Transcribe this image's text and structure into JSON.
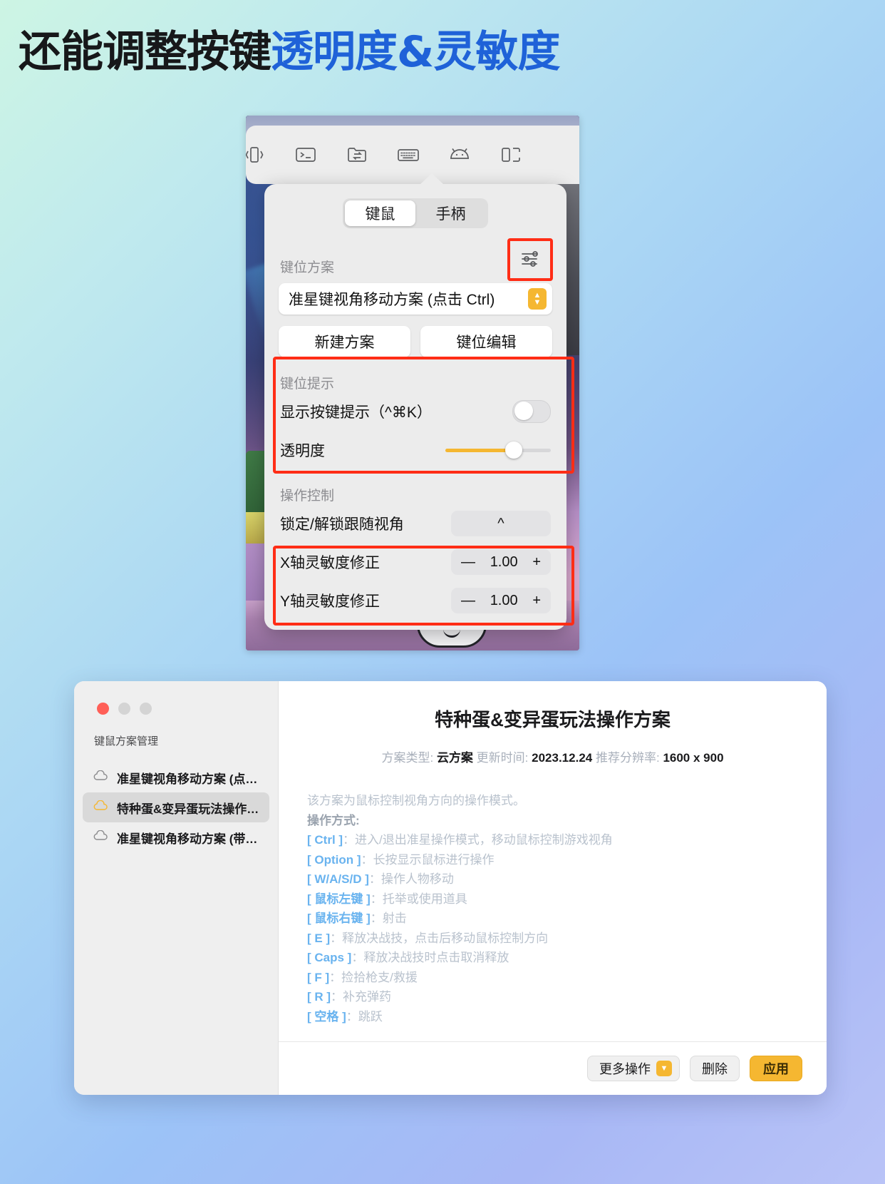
{
  "title": {
    "black": "还能调整按键",
    "blue": "透明度&灵敏度"
  },
  "colors": {
    "accent_blue": "#1f62d8",
    "accent_yellow": "#f5b731",
    "annotation_red": "#ff2d16"
  },
  "mirror_toolbar": {
    "icons": [
      {
        "name": "shake-device-icon",
        "label": "摇一摇"
      },
      {
        "name": "terminal-icon",
        "label": "终端"
      },
      {
        "name": "file-transfer-icon",
        "label": "文件传输"
      },
      {
        "name": "keyboard-icon",
        "label": "键鼠方案"
      },
      {
        "name": "android-icon",
        "label": "安卓"
      },
      {
        "name": "split-screen-icon",
        "label": "分屏"
      }
    ]
  },
  "popover": {
    "segments": [
      {
        "label": "键鼠",
        "active": true
      },
      {
        "label": "手柄",
        "active": false
      }
    ],
    "scheme_section": {
      "label": "键位方案",
      "settings_icon": "sliders-icon",
      "selected_scheme": "准星键视角移动方案 (点击 Ctrl)",
      "buttons": [
        {
          "label": "新建方案"
        },
        {
          "label": "键位编辑"
        }
      ]
    },
    "hint_section": {
      "label": "键位提示",
      "show_hint": {
        "label": "显示按键提示（^⌘K）",
        "toggle_on": false
      },
      "opacity": {
        "label": "透明度",
        "value_percent": 65
      }
    },
    "control_section": {
      "label": "操作控制",
      "lock_follow": {
        "label": "锁定/解锁跟随视角",
        "key": "^"
      },
      "x_sensitivity": {
        "label": "X轴灵敏度修正",
        "minus": "—",
        "value": "1.00",
        "plus": "+"
      },
      "y_sensitivity": {
        "label": "Y轴灵敏度修正",
        "minus": "—",
        "value": "1.00",
        "plus": "+"
      }
    }
  },
  "window": {
    "sidebar": {
      "title": "键鼠方案管理",
      "items": [
        {
          "label": "准星键视角移动方案 (点…",
          "icon": "cloud-icon",
          "active": false,
          "cloud_color": "#8b8b8d"
        },
        {
          "label": "特种蛋&变异蛋玩法操作…",
          "icon": "cloud-icon",
          "active": true,
          "cloud_color": "#f5b731"
        },
        {
          "label": "准星键视角移动方案 (带…",
          "icon": "cloud-icon",
          "active": false,
          "cloud_color": "#8b8b8d"
        }
      ]
    },
    "detail": {
      "title": "特种蛋&变异蛋玩法操作方案",
      "meta": {
        "type_label": "方案类型:",
        "type_value": "云方案",
        "updated_label": "更新时间:",
        "updated_value": "2023.12.24",
        "resolution_label": "推荐分辨率:",
        "resolution_value": "1600 x 900"
      },
      "description": "该方案为鼠标控制视角方向的操作模式。",
      "ops_label": "操作方式:",
      "mappings": [
        {
          "key": "[ Ctrl ]",
          "sep": "：",
          "desc": "进入/退出准星操作模式，移动鼠标控制游戏视角"
        },
        {
          "key": "[ Option ]",
          "sep": "：",
          "desc": "长按显示鼠标进行操作"
        },
        {
          "key": "[ W/A/S/D ]",
          "sep": "：",
          "desc": "操作人物移动"
        },
        {
          "key": "[ 鼠标左键 ]",
          "sep": "：",
          "desc": "托举或使用道具"
        },
        {
          "key": "[ 鼠标右键 ]",
          "sep": "：",
          "desc": "射击"
        },
        {
          "key": "[ E ]",
          "sep": "：",
          "desc": "释放决战技，点击后移动鼠标控制方向"
        },
        {
          "key": "[ Caps ]",
          "sep": "：",
          "desc": "释放决战技时点击取消释放"
        },
        {
          "key": "[ F ]",
          "sep": "：",
          "desc": "捡拾枪支/救援"
        },
        {
          "key": "[ R ]",
          "sep": "：",
          "desc": "补充弹药"
        },
        {
          "key": "[ 空格 ]",
          "sep": "：",
          "desc": "跳跃"
        }
      ]
    },
    "footer": {
      "more_label": "更多操作",
      "more_chevron": "chevron-down-icon",
      "delete_label": "删除",
      "apply_label": "应用"
    }
  }
}
